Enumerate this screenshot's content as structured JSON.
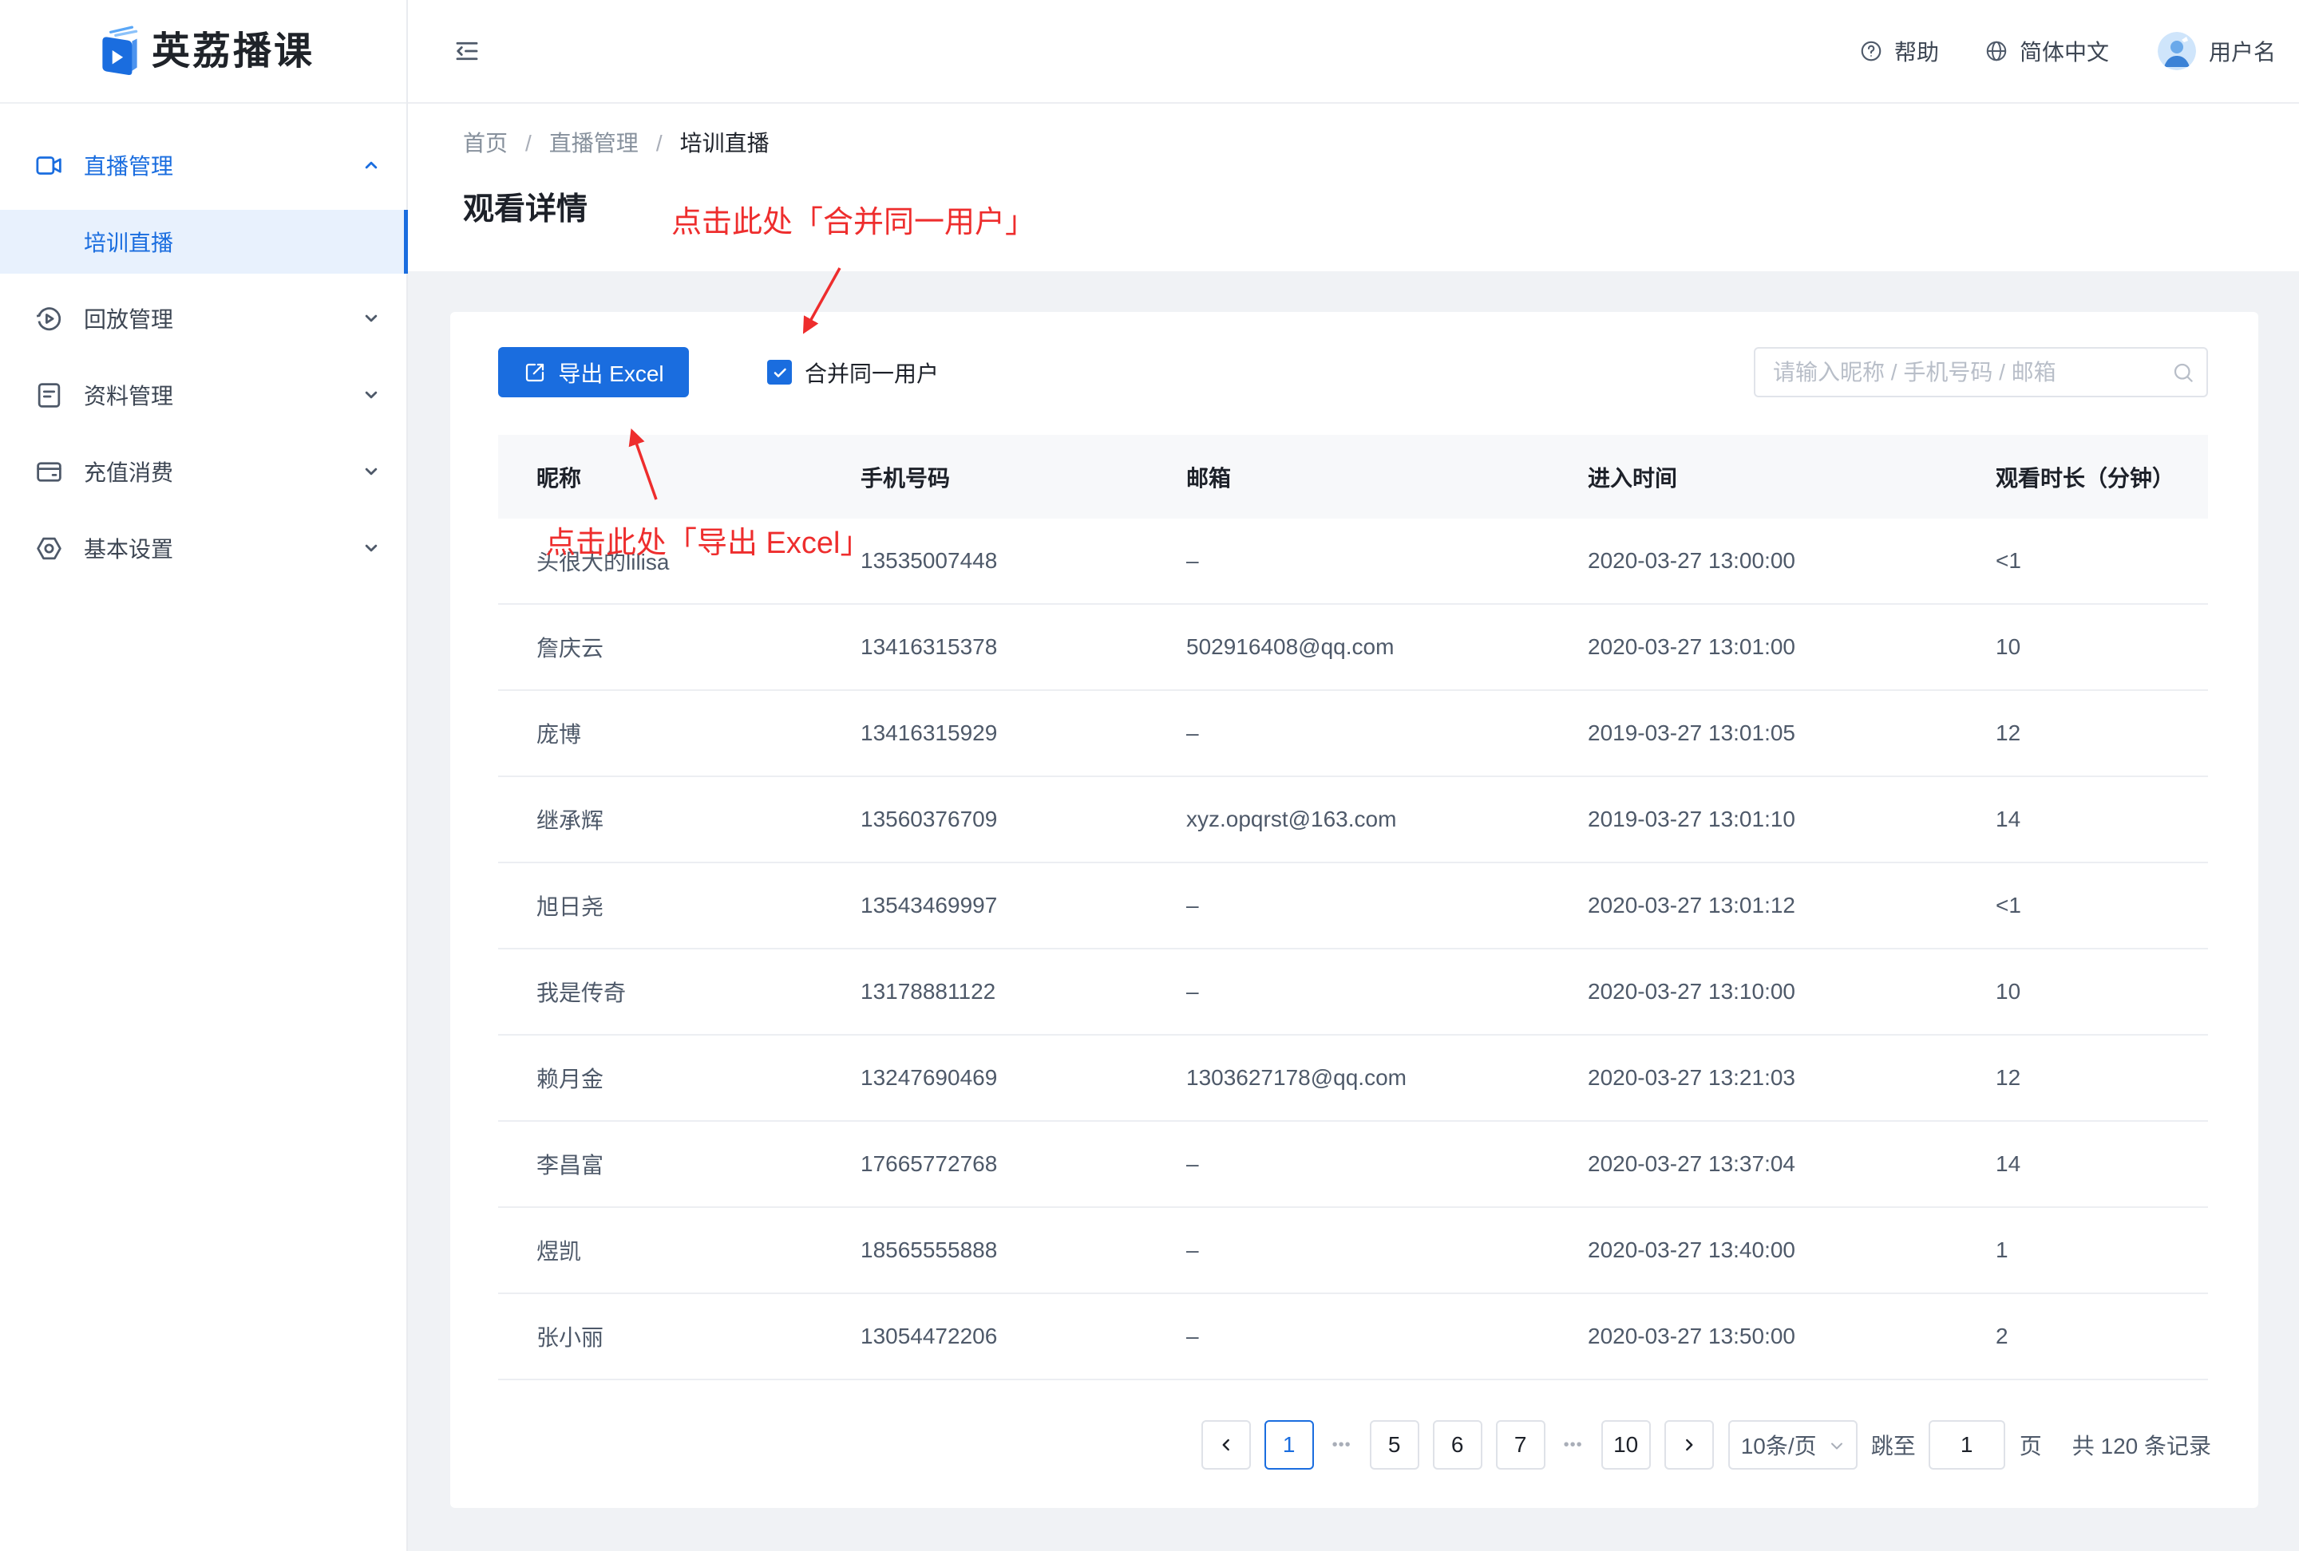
{
  "app": {
    "name": "英荔播课"
  },
  "sidebar": {
    "items": [
      {
        "label": "直播管理",
        "icon": "video-camera-icon",
        "expanded": true,
        "children": [
          {
            "label": "培训直播",
            "active": true
          }
        ]
      },
      {
        "label": "回放管理",
        "icon": "replay-icon"
      },
      {
        "label": "资料管理",
        "icon": "document-icon"
      },
      {
        "label": "充值消费",
        "icon": "wallet-icon"
      },
      {
        "label": "基本设置",
        "icon": "settings-icon"
      }
    ]
  },
  "header": {
    "menu_icon": "menu-fold-icon",
    "help_label": "帮助",
    "language_label": "简体中文",
    "username": "用户名"
  },
  "breadcrumb": {
    "items": [
      "首页",
      "直播管理",
      "培训直播"
    ],
    "separator": "/"
  },
  "page": {
    "title": "观看详情"
  },
  "toolbar": {
    "export_label": "导出 Excel",
    "merge_label": "合并同一用户",
    "merge_checked": true,
    "search_placeholder": "请输入昵称 / 手机号码 / 邮箱"
  },
  "table": {
    "columns": [
      "昵称",
      "手机号码",
      "邮箱",
      "进入时间",
      "观看时长（分钟）"
    ],
    "rows": [
      {
        "nickname": "头很大的lilisa",
        "phone": "13535007448",
        "email": "–",
        "entered_at": "2020-03-27 13:00:00",
        "duration": "<1"
      },
      {
        "nickname": "詹庆云",
        "phone": "13416315378",
        "email": "502916408@qq.com",
        "entered_at": "2020-03-27 13:01:00",
        "duration": "10"
      },
      {
        "nickname": "庞博",
        "phone": "13416315929",
        "email": "–",
        "entered_at": "2019-03-27 13:01:05",
        "duration": "12"
      },
      {
        "nickname": "继承辉",
        "phone": "13560376709",
        "email": "xyz.opqrst@163.com",
        "entered_at": "2019-03-27 13:01:10",
        "duration": "14"
      },
      {
        "nickname": "旭日尧",
        "phone": "13543469997",
        "email": "–",
        "entered_at": "2020-03-27 13:01:12",
        "duration": "<1"
      },
      {
        "nickname": "我是传奇",
        "phone": "13178881122",
        "email": "–",
        "entered_at": "2020-03-27 13:10:00",
        "duration": "10"
      },
      {
        "nickname": "赖月金",
        "phone": "13247690469",
        "email": "1303627178@qq.com",
        "entered_at": "2020-03-27 13:21:03",
        "duration": "12"
      },
      {
        "nickname": "李昌富",
        "phone": "17665772768",
        "email": "–",
        "entered_at": "2020-03-27 13:37:04",
        "duration": "14"
      },
      {
        "nickname": "煜凯",
        "phone": "18565555888",
        "email": "–",
        "entered_at": "2020-03-27 13:40:00",
        "duration": "1"
      },
      {
        "nickname": "张小丽",
        "phone": "13054472206",
        "email": "–",
        "entered_at": "2020-03-27 13:50:00",
        "duration": "2"
      }
    ]
  },
  "pagination": {
    "pages": [
      {
        "label": "1",
        "active": true
      },
      {
        "label": "5"
      },
      {
        "label": "6"
      },
      {
        "label": "7"
      },
      {
        "label": "10"
      }
    ],
    "ellipsis": "•••",
    "page_size_label": "10条/页",
    "jump_label": "跳至",
    "jump_value": "1",
    "page_suffix": "页",
    "total_label": "共 120 条记录"
  },
  "annotations": {
    "merge_hint": "点击此处「合并同一用户」",
    "export_hint": "点击此处「导出 Excel」"
  },
  "colors": {
    "primary": "#1a6ddf",
    "annotation": "#ee2d2d"
  }
}
